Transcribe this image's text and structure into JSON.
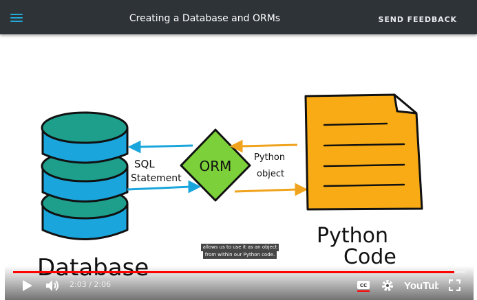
{
  "header": {
    "title": "Creating a Database and ORMs",
    "feedback_label": "SEND FEEDBACK",
    "accent_color": "#22a7d6",
    "menu_icon": "hamburger-menu-icon"
  },
  "video": {
    "illustration": {
      "orm_label": "ORM",
      "sql_label_line1": "SQL",
      "sql_label_line2": "Statement",
      "python_object_line1": "Python",
      "python_object_line2": "object",
      "database_label": "Database",
      "python_code_line1": "Python",
      "python_code_line2": "Code"
    },
    "caption_lines": [
      "allows us to use it as an object",
      "from within our Python code."
    ],
    "player": {
      "current_time": "2:03",
      "separator": "/",
      "duration": "2:06",
      "progress_fraction": 0.976,
      "progress_color": "#ff0000",
      "icons": {
        "play": "play-icon",
        "volume": "volume-icon",
        "captions": "closed-captions-icon",
        "settings": "settings-gear-icon",
        "youtube": "youtube-logo-icon",
        "fullscreen": "fullscreen-icon"
      },
      "youtube_label": "YouTube"
    }
  }
}
